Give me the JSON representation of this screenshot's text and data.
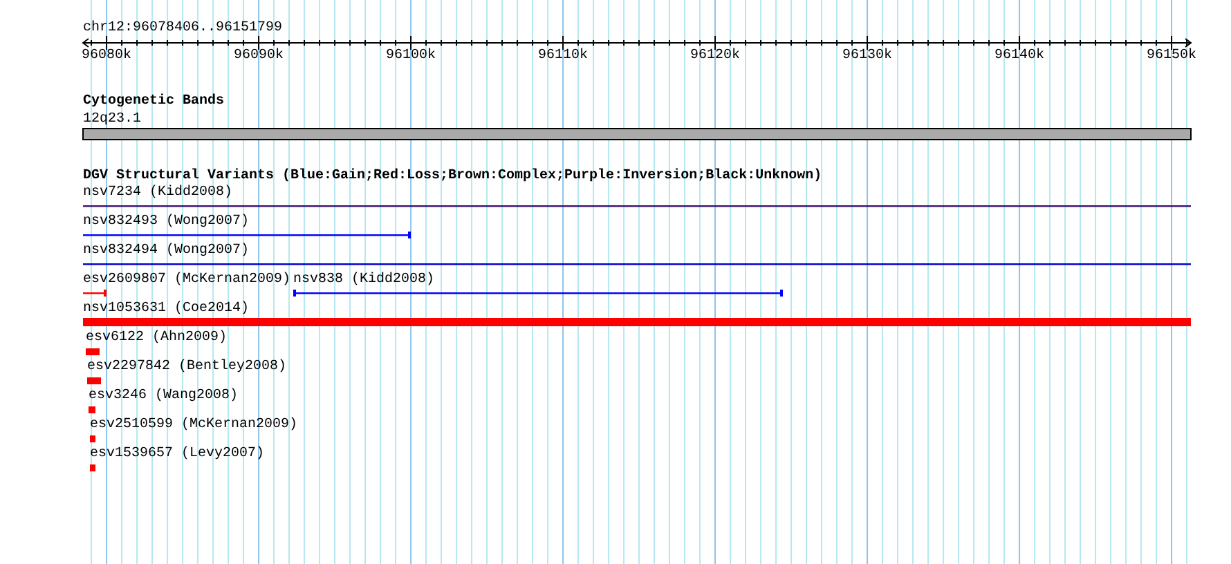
{
  "region": "chr12:96078406..96151799",
  "ruler": {
    "ticks": [
      "96080k",
      "96090k",
      "96100k",
      "96110k",
      "96120k",
      "96130k",
      "96140k",
      "96150k"
    ]
  },
  "tracks": [
    {
      "title": "Cytogenetic Bands",
      "features": [
        {
          "label": "12q23.1",
          "kind": "band",
          "color": "#aaaaaa"
        }
      ]
    },
    {
      "title": "DGV Structural Variants (Blue:Gain;Red:Loss;Brown:Complex;Purple:Inversion;Black:Unknown)",
      "features": [
        {
          "label": "nsv7234 (Kidd2008)",
          "kind": "line",
          "color": "#3c1470"
        },
        {
          "label": "nsv832493 (Wong2007)",
          "kind": "line",
          "color": "#0000ff"
        },
        {
          "label": "nsv832494 (Wong2007)",
          "kind": "line",
          "color": "#0000cc"
        },
        {
          "label": "esv2609807 (McKernan2009)",
          "kind": "line",
          "color": "#ff0000"
        },
        {
          "label": "nsv838 (Kidd2008)",
          "kind": "line",
          "color": "#0000ff"
        },
        {
          "label": "nsv1053631 (Coe2014)",
          "kind": "bar",
          "color": "#ff0000"
        },
        {
          "label": "esv6122 (Ahn2009)",
          "kind": "block",
          "color": "#ff0000"
        },
        {
          "label": "esv2297842 (Bentley2008)",
          "kind": "block",
          "color": "#ff0000"
        },
        {
          "label": "esv3246 (Wang2008)",
          "kind": "block",
          "color": "#ff0000"
        },
        {
          "label": "esv2510599 (McKernan2009)",
          "kind": "block",
          "color": "#ff0000"
        },
        {
          "label": "esv1539657 (Levy2007)",
          "kind": "block",
          "color": "#ff0000"
        }
      ]
    }
  ]
}
